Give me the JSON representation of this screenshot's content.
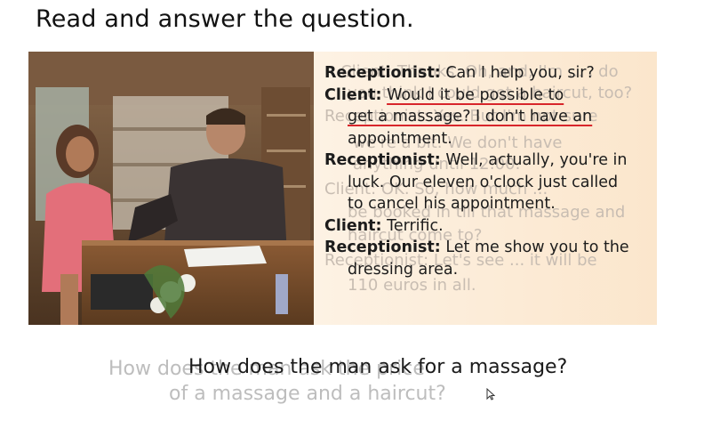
{
  "heading": "Read and answer the question.",
  "dialogue": [
    {
      "speaker": "Receptionist:",
      "lines": [
        "Can I help you, sir?"
      ]
    },
    {
      "speaker": "Client:",
      "lines": [
        "Would it be possible to",
        "get a massage? I don't have an",
        "appointment."
      ]
    },
    {
      "speaker": "Receptionist:",
      "lines": [
        "Well, actually, you're in",
        "luck. Our eleven o'clock just called",
        "to cancel his appointment."
      ]
    },
    {
      "speaker": "Client:",
      "lines": [
        "Terrific."
      ]
    },
    {
      "speaker": "Receptionist:",
      "lines": [
        "Let me show you to the",
        "dressing area."
      ]
    }
  ],
  "ghost_text": {
    "l1": "Client: Thanks. Oh, and, I'm ... , do",
    "l2": "you think I could get a haircut, too?",
    "l3": "Receptionist: Yes. But I'm not sure",
    "l4": "we're a bit. We don't have",
    "l5": "anything until 12:00.",
    "l6": "Client: OK. So, how much ...",
    "l7": "be booked in till that massage and",
    "l8": "haircut come to?",
    "l9": "Receptionist: Let's see ... it will be",
    "l10": "110 euros in all."
  },
  "question": "How does the man ask for a massage?",
  "question_ghost_1": "How does the man ask the price",
  "question_ghost_2": "of a massage and a haircut?",
  "colors": {
    "underline": "#d8262b",
    "panel": "#fbe6cc"
  }
}
